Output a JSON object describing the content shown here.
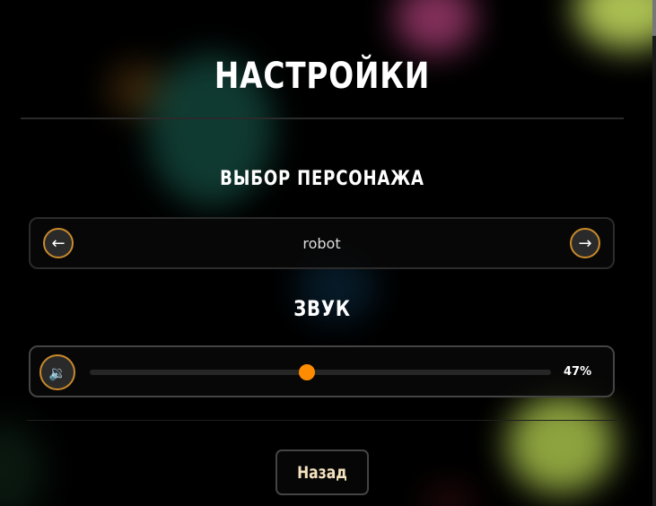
{
  "settings": {
    "title": "НАСТРОЙКИ",
    "character_section": {
      "heading": "ВЫБОР ПЕРСОНАЖА",
      "prev_icon": "←",
      "next_icon": "→",
      "current_character": "robot"
    },
    "sound_section": {
      "heading": "ЗВУК",
      "mute_icon": "🔉",
      "volume_percent": 47,
      "volume_label": "47%"
    },
    "back_button_label": "Назад",
    "colors": {
      "accent": "#ff8c00",
      "button_border": "#c98a2a",
      "back_text": "#f5e3bf"
    }
  }
}
